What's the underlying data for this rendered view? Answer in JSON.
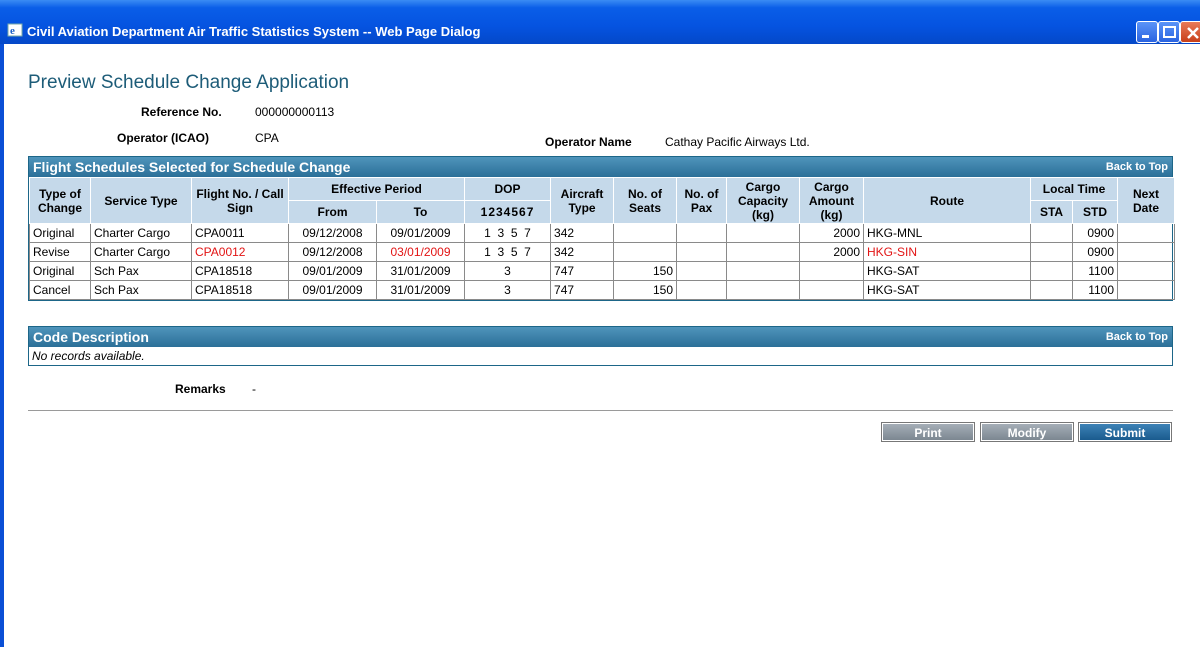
{
  "window": {
    "title": "Civil Aviation Department Air Traffic Statistics System -- Web Page Dialog"
  },
  "page": {
    "title": "Preview Schedule Change Application",
    "reference_label": "Reference No.",
    "reference_value": "000000000113",
    "operator_icao_label": "Operator (ICAO)",
    "operator_icao_value": "CPA",
    "operator_name_label": "Operator Name",
    "operator_name_value": "Cathay Pacific Airways Ltd.",
    "remarks_label": "Remarks",
    "remarks_value": "-"
  },
  "schedules": {
    "heading": "Flight Schedules Selected for Schedule Change",
    "back_to_top": "Back to Top",
    "headers": {
      "type_of_change": "Type of Change",
      "service_type": "Service Type",
      "flight_no": "Flight No. / Call Sign",
      "effective_period": "Effective Period",
      "from": "From",
      "to": "To",
      "dop": "DOP",
      "dop_digits": "1234567",
      "aircraft_type": "Aircraft Type",
      "no_of_seats": "No. of Seats",
      "no_of_pax": "No. of Pax",
      "cargo_capacity": "Cargo Capacity (kg)",
      "cargo_amount": "Cargo Amount (kg)",
      "route": "Route",
      "local_time": "Local Time",
      "sta": "STA",
      "std": "STD",
      "next_date": "Next Date"
    },
    "rows": [
      {
        "type": "Original",
        "service": "Charter Cargo",
        "flight": "CPA0011",
        "from": "09/12/2008",
        "to": "09/01/2009",
        "dop": "1  3  5  7",
        "aircraft": "342",
        "seats": "",
        "pax": "",
        "cargo_cap": "",
        "cargo_amt": "2000",
        "route": "HKG-MNL",
        "sta": "",
        "std": "0900",
        "next": ""
      },
      {
        "type": "Revise",
        "service": "Charter Cargo",
        "flight": "CPA0012",
        "from": "09/12/2008",
        "to": "03/01/2009",
        "dop": "1  3  5  7",
        "aircraft": "342",
        "seats": "",
        "pax": "",
        "cargo_cap": "",
        "cargo_amt": "2000",
        "route": "HKG-SIN",
        "sta": "",
        "std": "0900",
        "next": ""
      },
      {
        "type": "Original",
        "service": "Sch Pax",
        "flight": "CPA18518",
        "from": "09/01/2009",
        "to": "31/01/2009",
        "dop": "3",
        "aircraft": "747",
        "seats": "150",
        "pax": "",
        "cargo_cap": "",
        "cargo_amt": "",
        "route": "HKG-SAT",
        "sta": "",
        "std": "1100",
        "next": ""
      },
      {
        "type": "Cancel",
        "service": "Sch Pax",
        "flight": "CPA18518",
        "from": "09/01/2009",
        "to": "31/01/2009",
        "dop": "3",
        "aircraft": "747",
        "seats": "150",
        "pax": "",
        "cargo_cap": "",
        "cargo_amt": "",
        "route": "HKG-SAT",
        "sta": "",
        "std": "1100",
        "next": ""
      }
    ]
  },
  "codes": {
    "heading": "Code Description",
    "back_to_top": "Back to Top",
    "empty_text": "No records available."
  },
  "buttons": {
    "print": "Print",
    "modify": "Modify",
    "submit": "Submit"
  },
  "colors": {
    "highlight_changed": "#e21414",
    "header_bg": "#2b6f98",
    "column_header_bg": "#c5d9ea"
  }
}
